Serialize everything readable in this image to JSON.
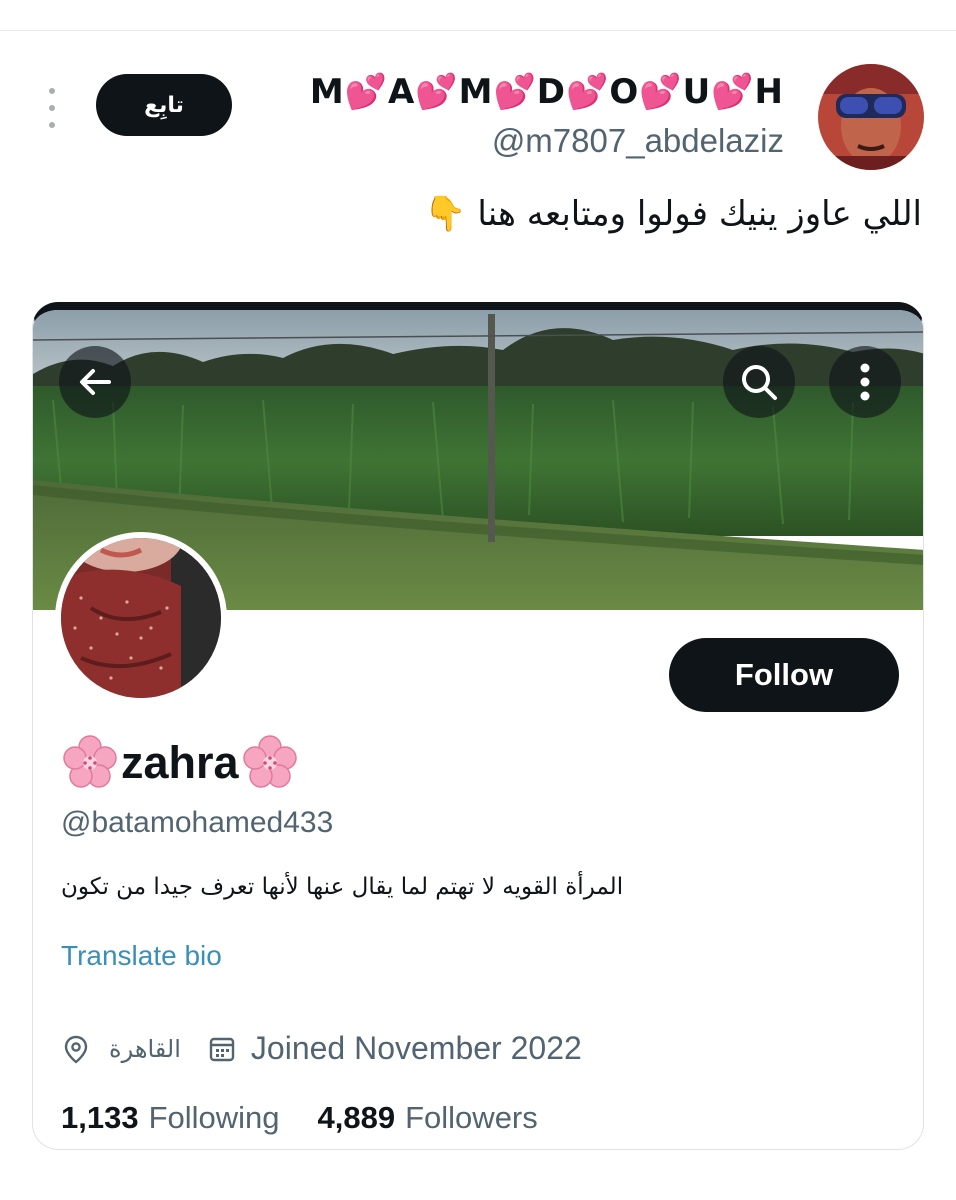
{
  "tweet": {
    "author_name": "M💕A💕M💕D💕O💕U💕H",
    "author_handle": "@m7807_abdelaziz",
    "follow_label": "تابِع",
    "text": "اللي عاوز ينيك فولوا ومتابعه هنا 👇"
  },
  "card": {
    "display_name": "zahra",
    "handle": "@batamohamed433",
    "follow_label": "Follow",
    "bio": "المرأة القويه لا تهتم لما يقال عنها لأنها تعرف جيدا من تكون",
    "translate_label": "Translate bio",
    "location": "القاهرة",
    "joined": "Joined November 2022",
    "following_count": "1,133",
    "following_label": "Following",
    "followers_count": "4,889",
    "followers_label": "Followers"
  },
  "icons": {
    "back": "arrow-left-icon",
    "search": "search-icon",
    "more": "more-vertical-icon",
    "location": "location-pin-icon",
    "calendar": "calendar-icon",
    "flower": "cherry-blossom-emoji"
  },
  "colors": {
    "button_bg": "#0f1419",
    "secondary_text": "#536471",
    "link": "#3a8fb8",
    "border": "#dfe3e6"
  }
}
